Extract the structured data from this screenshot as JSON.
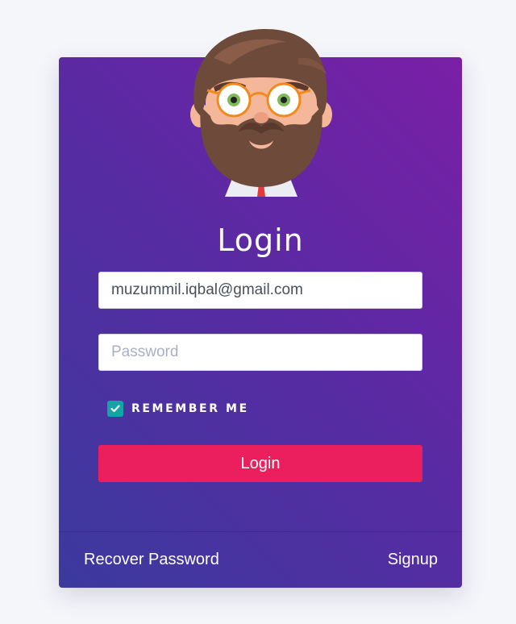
{
  "form": {
    "title": "Login",
    "email_value": "muzummil.iqbal@gmail.com",
    "password_placeholder": "Password",
    "remember_label": "REMEMBER ME",
    "remember_checked": true,
    "submit_label": "Login"
  },
  "footer": {
    "recover_label": "Recover Password",
    "signup_label": "Signup"
  },
  "icons": {
    "avatar": "bearded-man-avatar-icon",
    "checkmark": "check-icon"
  },
  "colors": {
    "page_background": "#f5f6fa",
    "card_gradient_top": "#7a1fa6",
    "card_gradient_bottom": "#3b3a9e",
    "button": "#ec1f5e",
    "checkbox": "#17a2a6"
  }
}
